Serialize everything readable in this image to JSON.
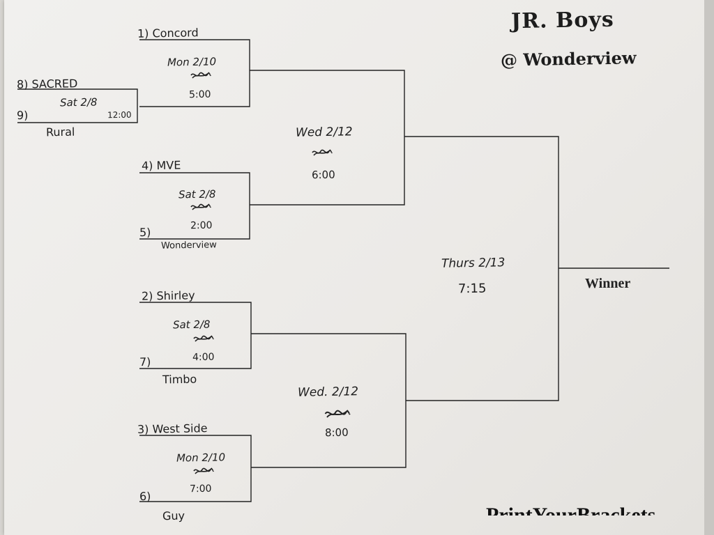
{
  "header": {
    "title": "JR. Boys",
    "venue": "@ Wonderview"
  },
  "teams": {
    "t1": "1) Concord",
    "t8": "8) SACRED",
    "t9": "9)",
    "t9_name": "Rural",
    "t4": "4) MVE",
    "t5": "5)",
    "t5_name": "Wonderview",
    "t2": "2) Shirley",
    "t7": "7)",
    "t7_name": "Timbo",
    "t3": "3) West Side",
    "t6": "6)",
    "t6_name": "Guy"
  },
  "games": {
    "g_8_9": {
      "date": "Sat 2/8",
      "time": "12:00"
    },
    "g_1": {
      "date": "Mon 2/10",
      "time": "5:00"
    },
    "g_4_5": {
      "date": "Sat 2/8",
      "time": "2:00"
    },
    "g_2_7": {
      "date": "Sat 2/8",
      "time": "4:00"
    },
    "g_3_6": {
      "date": "Mon 2/10",
      "time": "7:00"
    },
    "semi_top": {
      "date": "Wed 2/12",
      "time": "6:00"
    },
    "semi_bottom": {
      "date": "Wed. 2/12",
      "time": "8:00"
    },
    "final": {
      "date": "Thurs 2/13",
      "time": "7:15"
    }
  },
  "winner_label": "Winner",
  "brand": "PrintYourBrackets"
}
